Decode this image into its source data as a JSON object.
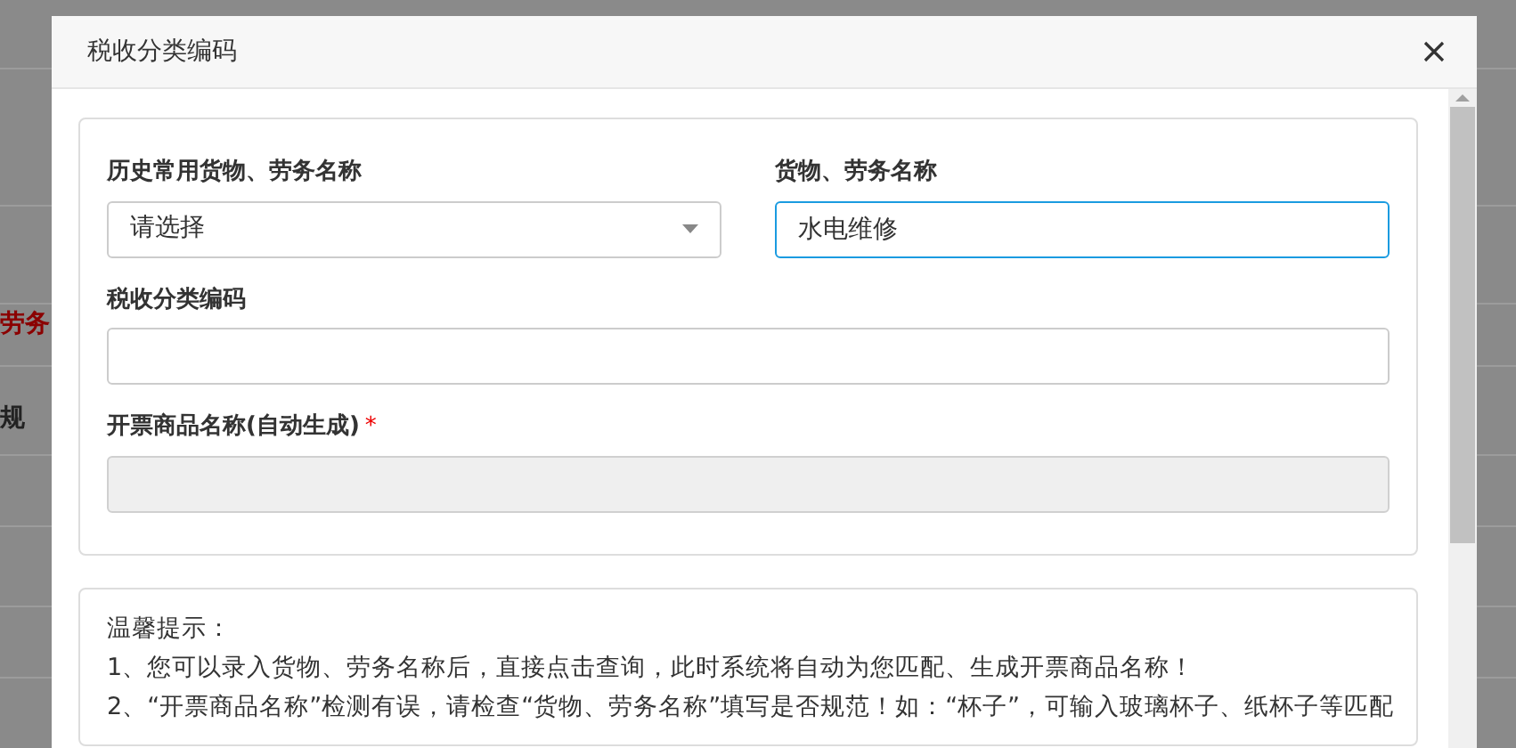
{
  "background": {
    "texts": [
      {
        "text": "劳务",
        "kind": "emphasis"
      },
      {
        "text": "规",
        "kind": "plain"
      }
    ]
  },
  "dialog": {
    "title": "税收分类编码",
    "rows": [
      [
        {
          "label": "历史常用货物、劳务名称",
          "kind": "select",
          "placeholder": "请选择",
          "focused": false,
          "required": false,
          "disabled": false
        },
        {
          "label": "货物、劳务名称",
          "kind": "text",
          "value": "水电维修",
          "focused": true,
          "required": false,
          "disabled": false
        }
      ],
      [
        {
          "label": "税收分类编码",
          "kind": "text",
          "focused": false,
          "required": false,
          "disabled": false
        }
      ],
      [
        {
          "label": "开票商品名称(自动生成)",
          "kind": "text",
          "focused": false,
          "required": true,
          "required_mark": "*",
          "disabled": true
        }
      ]
    ],
    "tips": {
      "title": "温馨提示：",
      "lines": [
        "1、您可以录入货物、劳务名称后，直接点击查询，此时系统将自动为您匹配、生成开票商品名称！",
        "2、“开票商品名称”检测有误，请检查“货物、劳务名称”填写是否规范！如：“杯子”，可输入玻璃杯子、纸杯子等匹配"
      ]
    }
  }
}
